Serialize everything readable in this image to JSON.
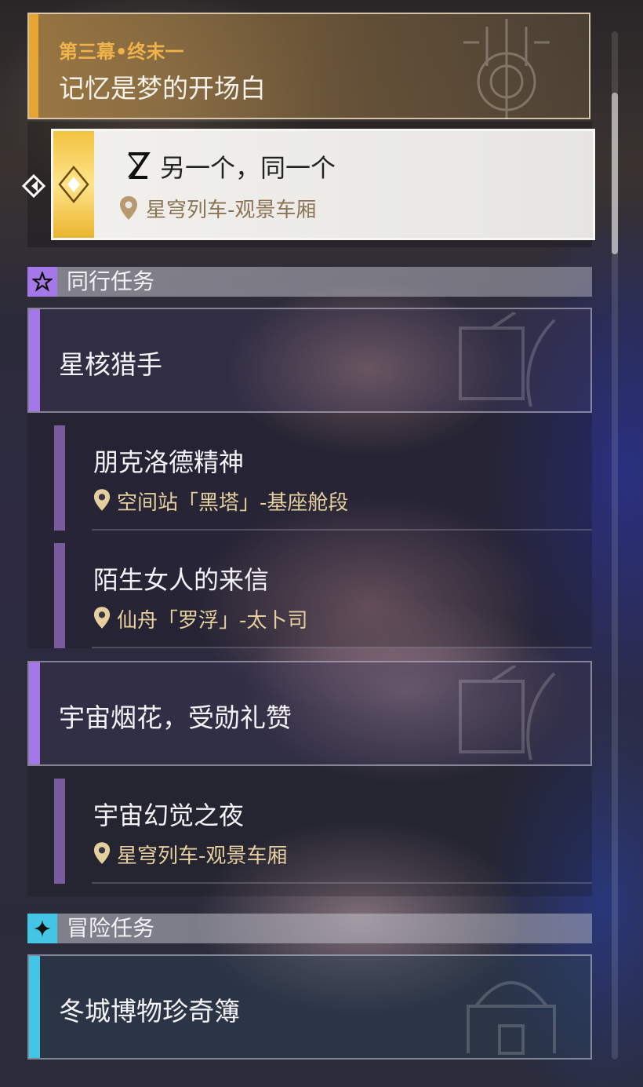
{
  "main_quest": {
    "act": "第三幕•终末一",
    "chapter_title": "记忆是梦的开场白",
    "active": {
      "title": "另一个，同一个",
      "location": "星穹列车-观景车厢"
    }
  },
  "sections": [
    {
      "label": "同行任务",
      "icon": "star-icon",
      "color": "#a478e8",
      "groups": [
        {
          "name": "星核猎手",
          "quests": [
            {
              "title": "朋克洛德精神",
              "location": "空间站「黑塔」-基座舱段"
            },
            {
              "title": "陌生女人的来信",
              "location": "仙舟「罗浮」-太卜司"
            }
          ]
        },
        {
          "name": "宇宙烟花，受勋礼赞",
          "quests": [
            {
              "title": "宇宙幻觉之夜",
              "location": "星穹列车-观景车厢"
            }
          ]
        }
      ]
    },
    {
      "label": "冒险任务",
      "icon": "sparkle-icon",
      "color": "#43c6e6",
      "groups": [
        {
          "name": "冬城博物珍奇簿",
          "quests": []
        }
      ]
    }
  ],
  "colors": {
    "main_accent": "#e7a532",
    "active_gold": "#f1c340",
    "location_text": "#e6cf9e"
  }
}
